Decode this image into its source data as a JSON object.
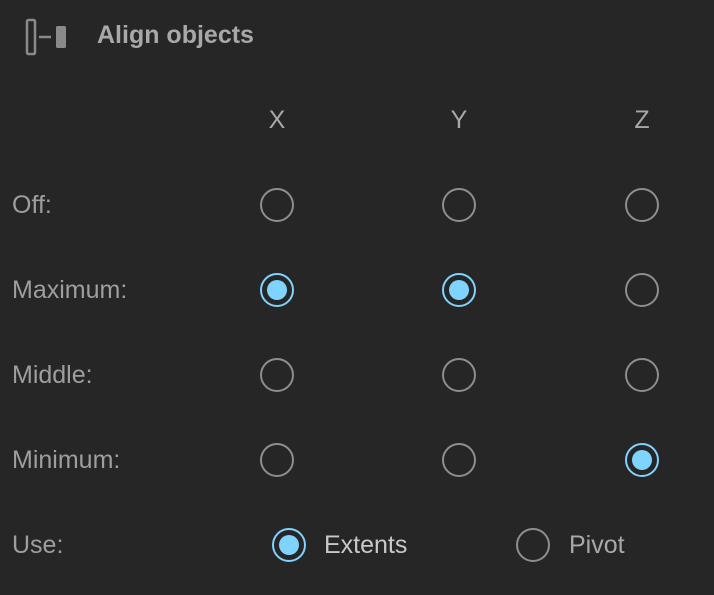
{
  "header": {
    "title": "Align objects",
    "icon": "align-objects-icon"
  },
  "columns": [
    "X",
    "Y",
    "Z"
  ],
  "rows": [
    {
      "label": "Off:",
      "selected": [
        false,
        false,
        false
      ]
    },
    {
      "label": "Maximum:",
      "selected": [
        true,
        true,
        false
      ]
    },
    {
      "label": "Middle:",
      "selected": [
        false,
        false,
        false
      ]
    },
    {
      "label": "Minimum:",
      "selected": [
        false,
        false,
        true
      ]
    }
  ],
  "use": {
    "label": "Use:",
    "options": [
      {
        "label": "Extents",
        "selected": true
      },
      {
        "label": "Pivot",
        "selected": false
      }
    ]
  },
  "colors": {
    "background": "#262626",
    "accent": "#7fd3ff",
    "radio_border": "#8e8e8e",
    "text": "#9e9e9e"
  }
}
